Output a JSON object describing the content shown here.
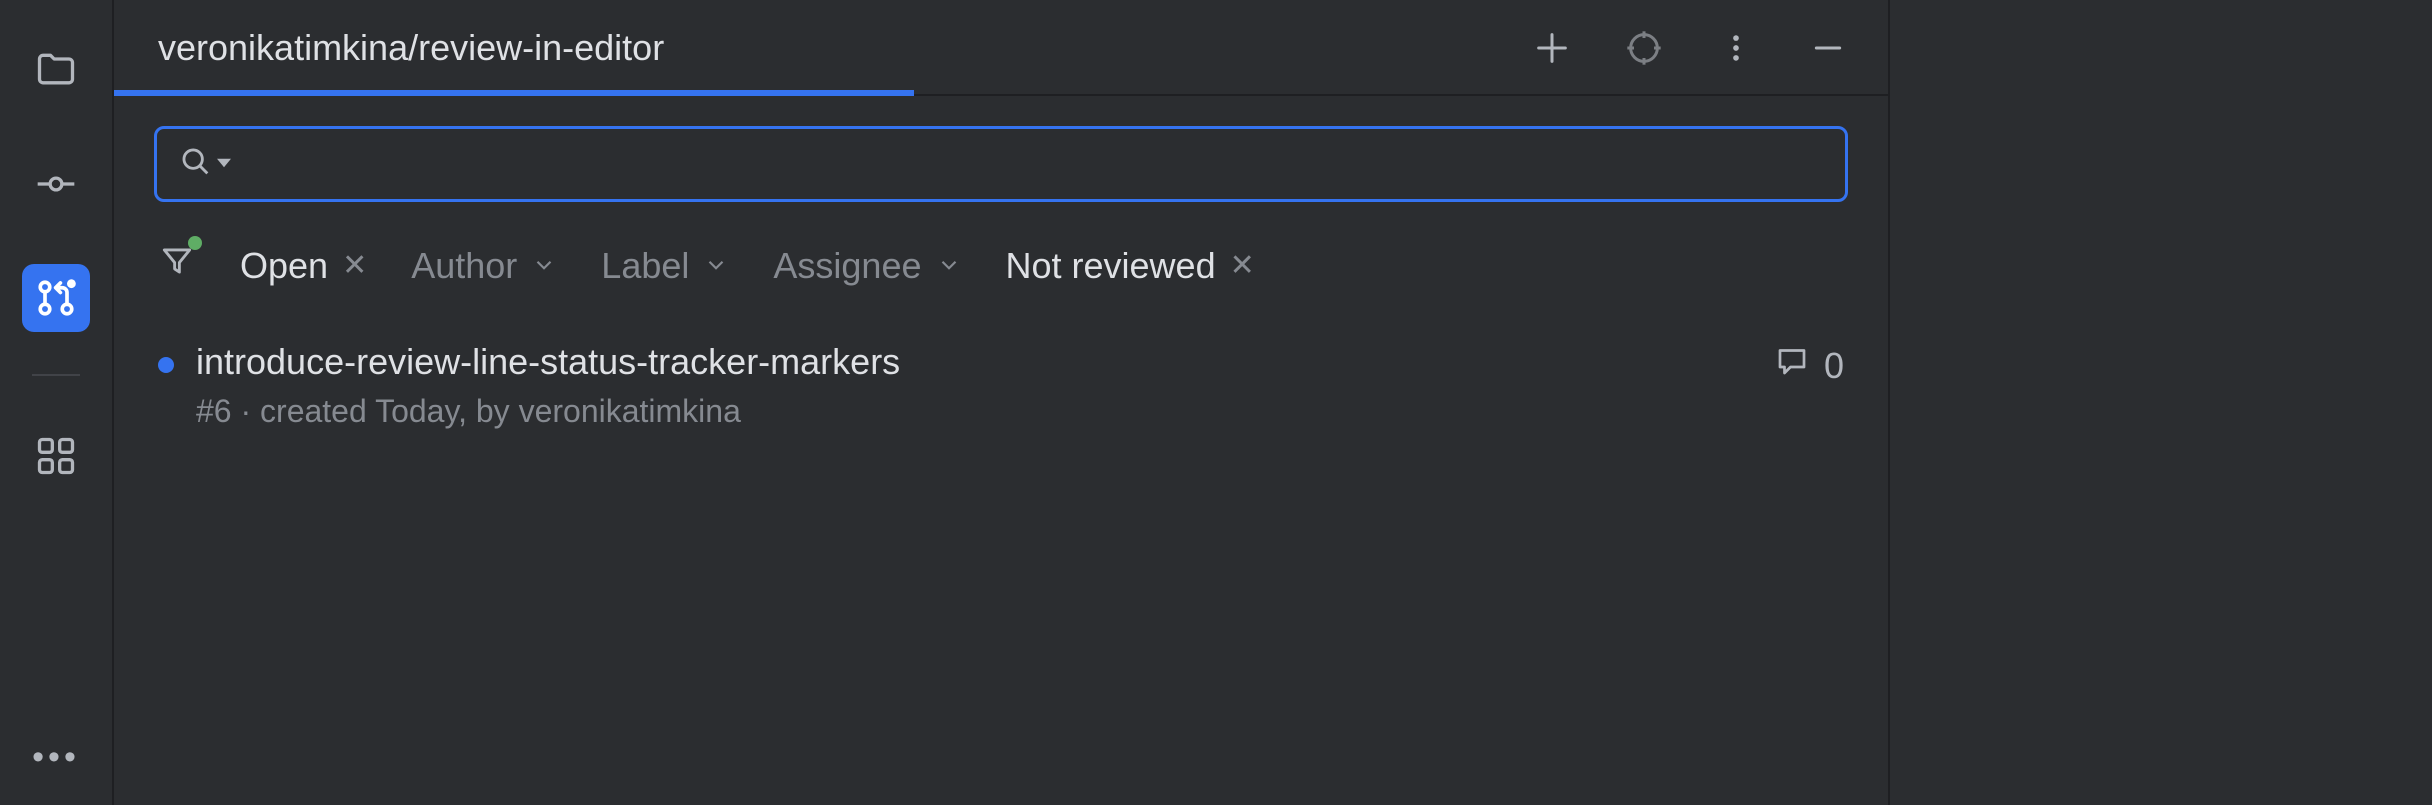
{
  "colors": {
    "accent": "#3573f0",
    "bg": "#2b2d30",
    "muted": "#868a91",
    "text": "#dfe1e5"
  },
  "header": {
    "title": "veronikatimkina/review-in-editor"
  },
  "search": {
    "value": "",
    "placeholder": ""
  },
  "filters": {
    "open": {
      "label": "Open",
      "active": true,
      "closable": true
    },
    "author": {
      "label": "Author"
    },
    "labelf": {
      "label": "Label"
    },
    "assignee": {
      "label": "Assignee"
    },
    "not_reviewed": {
      "label": "Not reviewed",
      "active": true,
      "closable": true
    }
  },
  "items": [
    {
      "title": "introduce-review-line-status-tracker-markers",
      "meta": "#6 · created Today, by veronikatimkina",
      "comments": "0"
    }
  ]
}
